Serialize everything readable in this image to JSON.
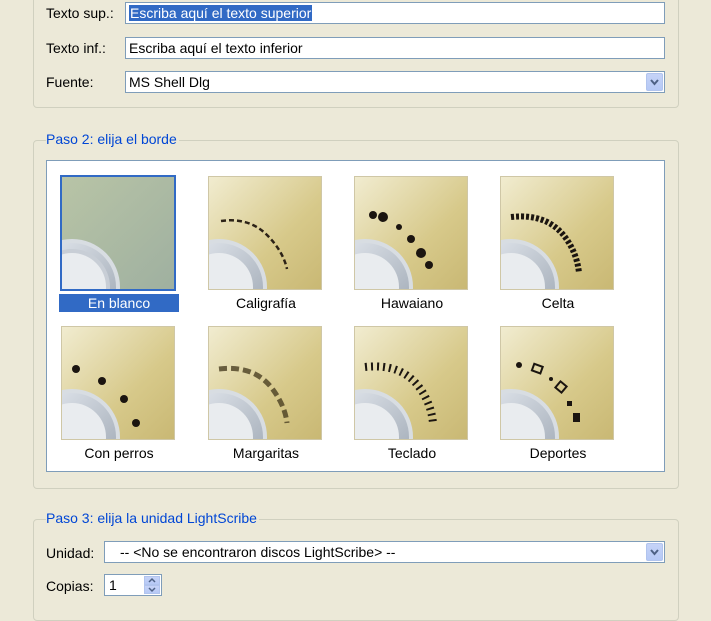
{
  "step1": {
    "top_text_label": "Texto sup.:",
    "top_text_value": "Escriba aquí el texto superior",
    "bottom_text_label": "Texto inf.:",
    "bottom_text_value": "Escriba aquí el texto inferior",
    "font_label": "Fuente:",
    "font_value": "MS Shell Dlg"
  },
  "step2": {
    "title": "Paso 2: elija el borde",
    "borders": [
      {
        "label": "En blanco",
        "selected": true
      },
      {
        "label": "Caligrafía"
      },
      {
        "label": "Hawaiano"
      },
      {
        "label": "Celta"
      },
      {
        "label": "Con perros"
      },
      {
        "label": "Margaritas"
      },
      {
        "label": "Teclado"
      },
      {
        "label": "Deportes"
      }
    ]
  },
  "step3": {
    "title": "Paso 3: elija la unidad LightScribe",
    "drive_label": "Unidad:",
    "drive_value": "-- <No se encontraron discos LightScribe> --",
    "copies_label": "Copias:",
    "copies_value": "1"
  },
  "colors": {
    "group_title": "#0046d5",
    "selection": "#316ac5",
    "disc_gold": "#d7c98a"
  }
}
